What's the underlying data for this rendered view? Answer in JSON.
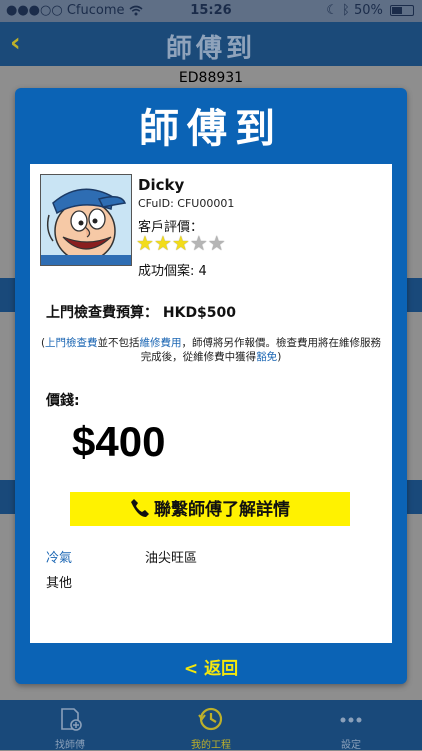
{
  "status_bar": {
    "signal": "●●●○○",
    "carrier": "Cfucome",
    "time": "15:26",
    "battery": "50%"
  },
  "nav": {
    "back_icon": "chevron-left",
    "title": "師傅到"
  },
  "background": {
    "order_id": "ED88931"
  },
  "modal": {
    "title": "師傅到",
    "technician": {
      "name": "Dicky",
      "cfuid": "CFuID: CFU00001",
      "rating_label": "客戶評價：",
      "rating": 3,
      "rating_max": 5,
      "cases": "成功個案: 4"
    },
    "budget": "上門檢查費預算： HKD$500",
    "note": {
      "p1": "(",
      "link1": "上門檢查費",
      "p2": "並不包括",
      "link2": "維修費用",
      "p3": "，師傅將另作報價。檢查費用將在維修服務完成後，從維修費中獲得",
      "link3": "豁免",
      "p4": ")"
    },
    "price_label": "價錢:",
    "price": "$400",
    "contact_button": "聯繫師傅了解詳情",
    "category": "冷氣",
    "district": "油尖旺區",
    "other": "其他",
    "back_button": "< 返回"
  },
  "tabs": [
    {
      "label": "找師傅",
      "icon": "document-add-icon",
      "active": false
    },
    {
      "label": "我的工程",
      "icon": "history-clock-icon",
      "active": true
    },
    {
      "label": "設定",
      "icon": "more-dots-icon",
      "active": false
    }
  ],
  "colors": {
    "primary_blue": "#0b63b5",
    "nav_blue": "#19497a",
    "accent_yellow": "#fff200",
    "link_blue": "#1b66b3",
    "star_on": "#f2dc1a"
  }
}
